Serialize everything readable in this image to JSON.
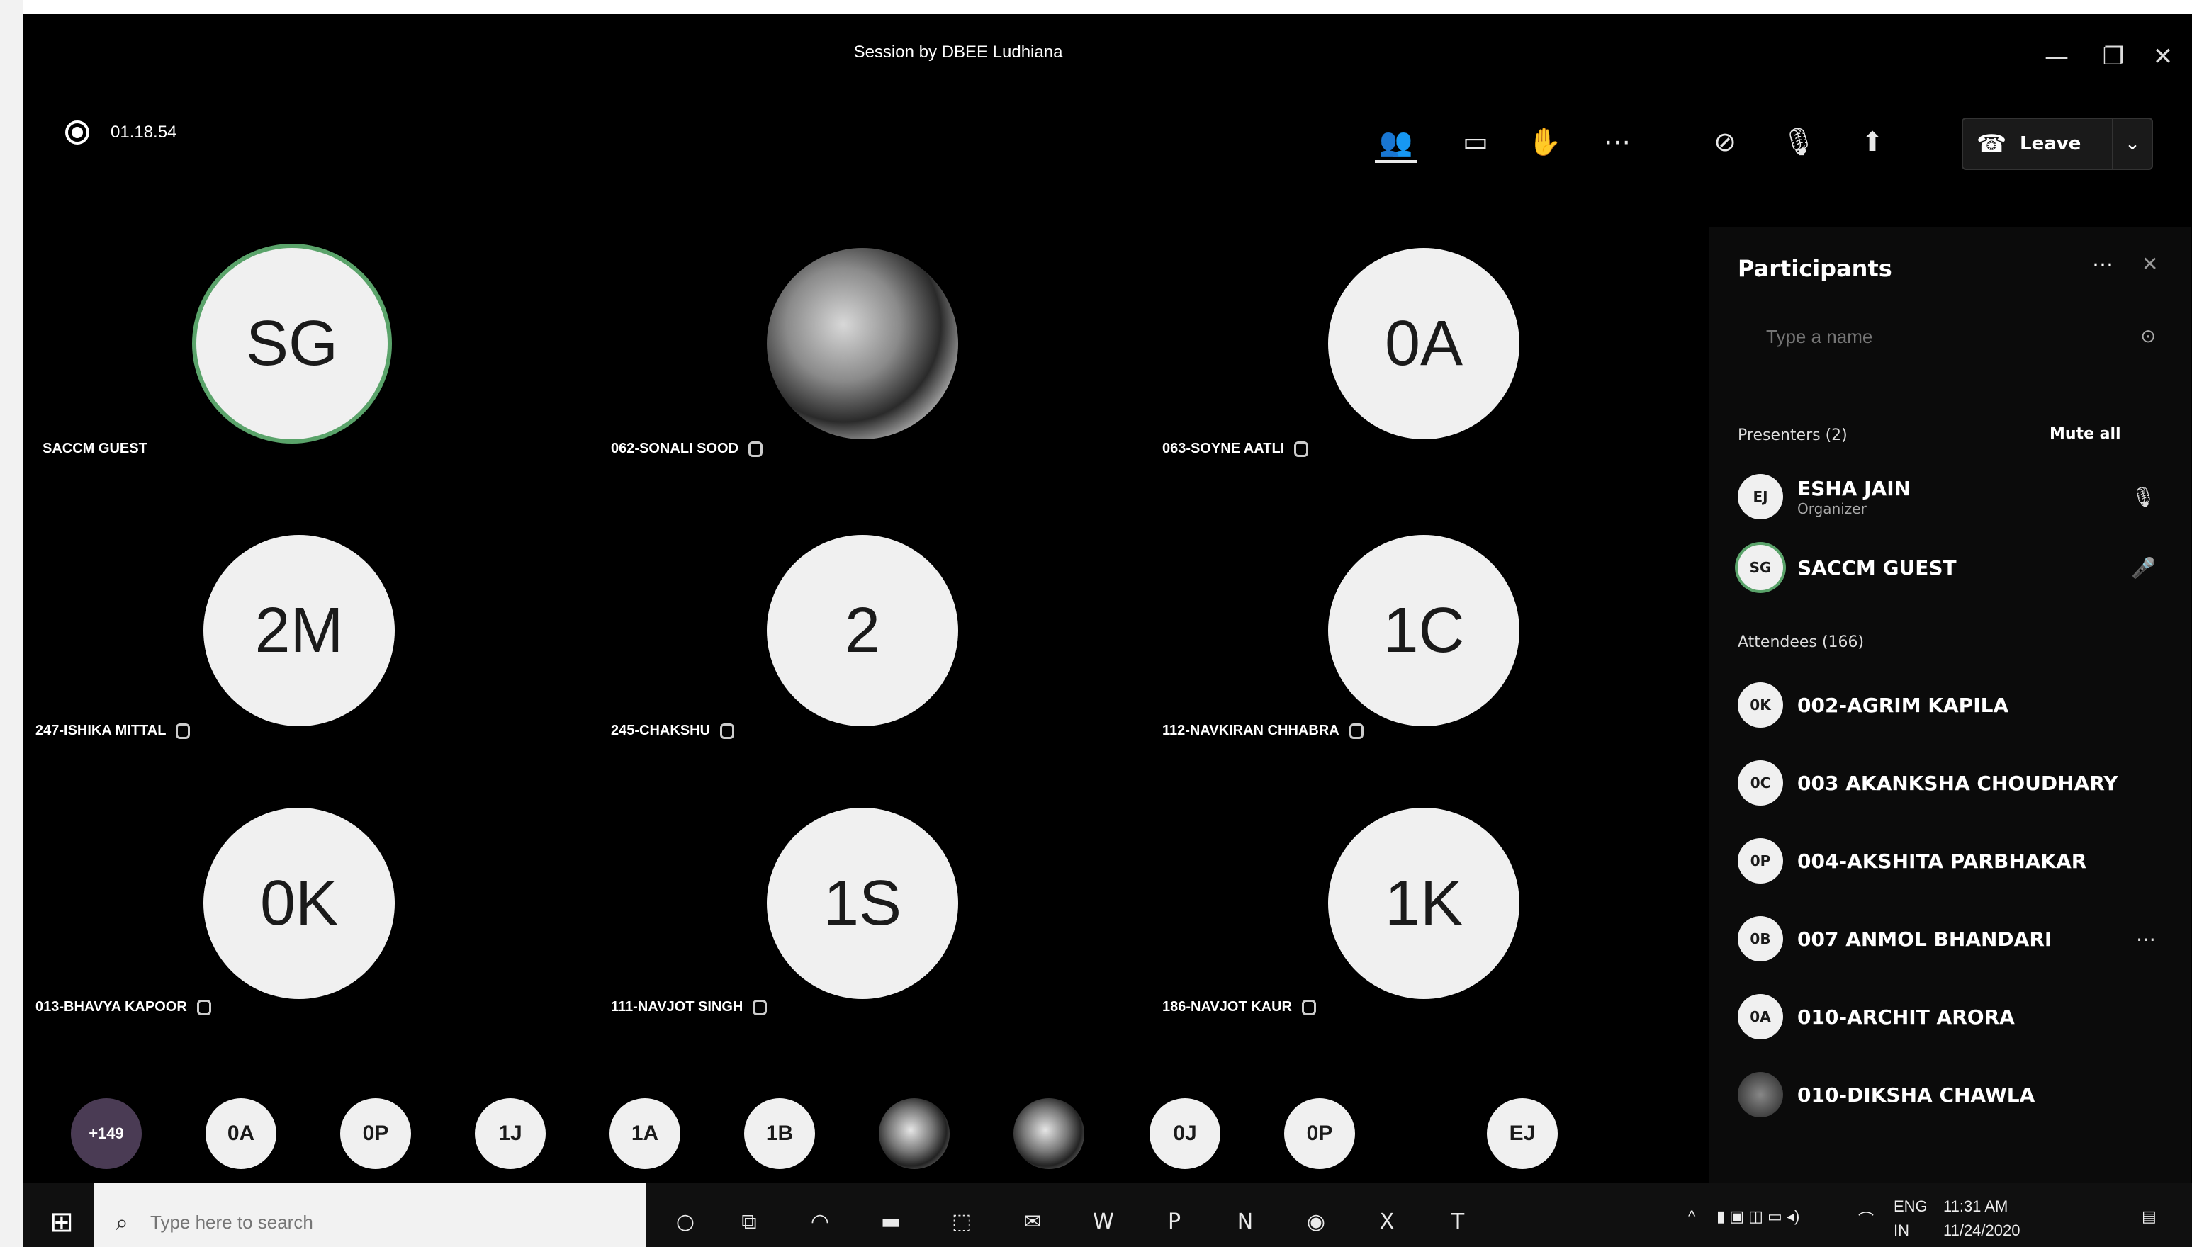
{
  "window": {
    "title": "Session by DBEE Ludhiana",
    "controls": {
      "minimize": "—",
      "maximize": "❐",
      "close": "✕"
    }
  },
  "toolbar": {
    "recording_time": "01.18.54",
    "leave_label": "Leave",
    "icons": [
      "participants-icon",
      "chat-icon",
      "raise-hand-icon",
      "more-icon",
      "camera-off-icon",
      "mic-off-icon",
      "share-icon"
    ]
  },
  "tiles": [
    {
      "initials": "SG",
      "name": "SACCM GUEST",
      "photo": false,
      "ring": true,
      "mic": false
    },
    {
      "initials": "",
      "name": "062-SONALI SOOD",
      "photo": true,
      "ring": false,
      "mic": true
    },
    {
      "initials": "0A",
      "name": "063-SOYNE AATLI",
      "photo": false,
      "ring": false,
      "mic": true
    },
    {
      "initials": "2M",
      "name": "247-ISHIKA MITTAL",
      "photo": false,
      "ring": false,
      "mic": true
    },
    {
      "initials": "2",
      "name": "245-CHAKSHU",
      "photo": false,
      "ring": false,
      "mic": true
    },
    {
      "initials": "1C",
      "name": "112-NAVKIRAN CHHABRA",
      "photo": false,
      "ring": false,
      "mic": true
    },
    {
      "initials": "0K",
      "name": "013-BHAVYA KAPOOR",
      "photo": false,
      "ring": false,
      "mic": true
    },
    {
      "initials": "1S",
      "name": "111-NAVJOT SINGH",
      "photo": false,
      "ring": false,
      "mic": true
    },
    {
      "initials": "1K",
      "name": "186-NAVJOT KAUR",
      "photo": false,
      "ring": false,
      "mic": true
    }
  ],
  "strip": [
    {
      "label": "+149",
      "kind": "more"
    },
    {
      "label": "0A",
      "kind": "initials"
    },
    {
      "label": "0P",
      "kind": "initials"
    },
    {
      "label": "1J",
      "kind": "initials"
    },
    {
      "label": "1A",
      "kind": "initials"
    },
    {
      "label": "1B",
      "kind": "initials"
    },
    {
      "label": "",
      "kind": "photo"
    },
    {
      "label": "",
      "kind": "photo"
    },
    {
      "label": "0J",
      "kind": "initials"
    },
    {
      "label": "0P",
      "kind": "initials"
    },
    {
      "label": "EJ",
      "kind": "initials"
    }
  ],
  "panel": {
    "title": "Participants",
    "search_placeholder": "Type a name",
    "presenters_label": "Presenters (2)",
    "mute_all": "Mute all",
    "attendees_label": "Attendees (166)",
    "presenters": [
      {
        "initials": "EJ",
        "name": "ESHA JAIN",
        "role": "Organizer",
        "icon": "mic-off-icon"
      },
      {
        "initials": "SG",
        "name": "SACCM GUEST",
        "role": "",
        "icon": "mic-icon"
      }
    ],
    "attendees": [
      {
        "initials": "0K",
        "name": "002-AGRIM KAPILA"
      },
      {
        "initials": "0C",
        "name": "003 AKANKSHA CHOUDHARY"
      },
      {
        "initials": "0P",
        "name": "004-AKSHITA PARBHAKAR"
      },
      {
        "initials": "0B",
        "name": "007 ANMOL BHANDARI"
      },
      {
        "initials": "0A",
        "name": "010-ARCHIT ARORA"
      },
      {
        "initials": "",
        "name": "010-DIKSHA CHAWLA"
      }
    ]
  },
  "taskbar": {
    "search_placeholder": "Type here to search",
    "lang_top": "ENG",
    "lang_bottom": "IN",
    "time": "11:31 AM",
    "date": "11/24/2020"
  }
}
